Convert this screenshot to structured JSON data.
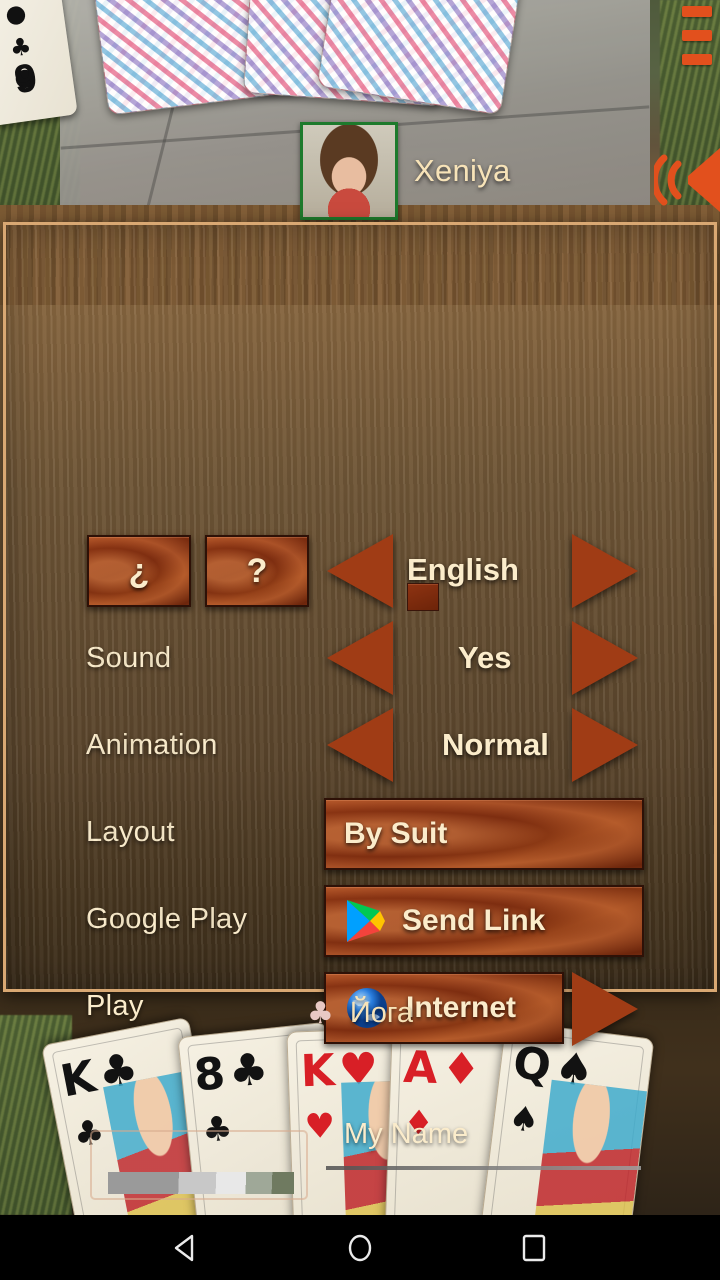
{
  "game": {
    "opponent": {
      "name": "Xeniya",
      "avatar_icon": "player-photo"
    },
    "hand_owner": {
      "suit_symbol": "♣",
      "name": "Йога"
    },
    "top_cards": [
      {
        "rank": "9",
        "suit": "♣",
        "color": "black",
        "face_down": false
      }
    ],
    "player_cards": [
      {
        "rank": "K",
        "suit": "♣",
        "color": "black"
      },
      {
        "rank": "8",
        "suit": "♣",
        "color": "black"
      },
      {
        "rank": "K",
        "suit": "♥",
        "color": "red"
      },
      {
        "rank": "A",
        "suit": "♦",
        "color": "red"
      },
      {
        "rank": "Q",
        "suit": "♠",
        "color": "black"
      }
    ],
    "overlay_icons": {
      "menu": "hamburger-menu-icon",
      "sound": "speaker-icon"
    }
  },
  "settings": {
    "help_buttons": [
      {
        "label": "¿",
        "name": "about-button"
      },
      {
        "label": "?",
        "name": "help-button"
      }
    ],
    "rows": [
      {
        "label": "",
        "value": "English",
        "control": "stepper",
        "has_flag": true
      },
      {
        "label": "Sound",
        "value": "Yes",
        "control": "stepper"
      },
      {
        "label": "Animation",
        "value": "Normal",
        "control": "stepper"
      },
      {
        "label": "Layout",
        "value": "By Suit",
        "control": "button"
      },
      {
        "label": "Google Play",
        "value": "Send Link",
        "control": "button",
        "icon": "google-play-icon"
      },
      {
        "label": "Play",
        "value": "Internet",
        "control": "button-arrow",
        "icon": "globe-icon"
      }
    ],
    "avatar_picker": {
      "name": "avatar-picker"
    },
    "name_field": {
      "placeholder": "My Name",
      "value": ""
    }
  },
  "navbar": {
    "back": "back-triangle-icon",
    "home": "home-circle-icon",
    "recents": "recents-square-icon"
  },
  "colors": {
    "panel_border": "#d9a873",
    "label_text": "#fbeccb",
    "wood_button": "#9e3c16",
    "accent_orange": "#e2501d",
    "avatar_border": "#1d7a2c"
  }
}
